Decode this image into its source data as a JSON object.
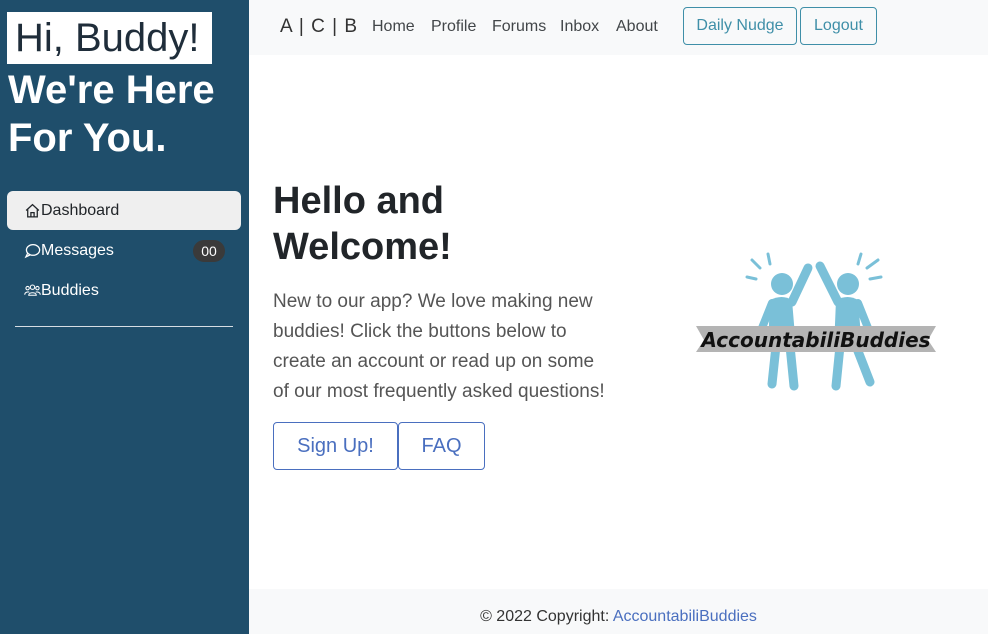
{
  "sidebar": {
    "greeting_badge": "Hi, Buddy!",
    "greeting_line1": "We're Here",
    "greeting_line2": "For You.",
    "items": [
      {
        "label": "Dashboard",
        "icon": "house-icon",
        "active": true
      },
      {
        "label": "Messages",
        "icon": "chat-icon",
        "badge": "00"
      },
      {
        "label": "Buddies",
        "icon": "people-icon"
      }
    ]
  },
  "topbar": {
    "brand": "A | C | B",
    "links": [
      "Home",
      "Profile",
      "Forums",
      "Inbox",
      "About"
    ],
    "nudge_label": "Daily Nudge",
    "logout_label": "Logout"
  },
  "hero": {
    "title_line1": "Hello and",
    "title_line2": "Welcome!",
    "body_lines": [
      "New to our app? We love making new",
      "buddies! Click the buttons below to",
      "create an account or read up on some",
      "of our most frequently asked questions!"
    ],
    "signup_label": "Sign Up!",
    "faq_label": "FAQ",
    "logo_text": "AccountabiliBuddies"
  },
  "footer": {
    "copyright": "© 2022 Copyright: ",
    "link_text": "AccountabiliBuddies"
  },
  "colors": {
    "sidebar_bg": "#1f4e6b",
    "accent_teal": "#3f8fa8",
    "accent_blue": "#4a6fbf",
    "logo_figure": "#7ac0d8"
  }
}
